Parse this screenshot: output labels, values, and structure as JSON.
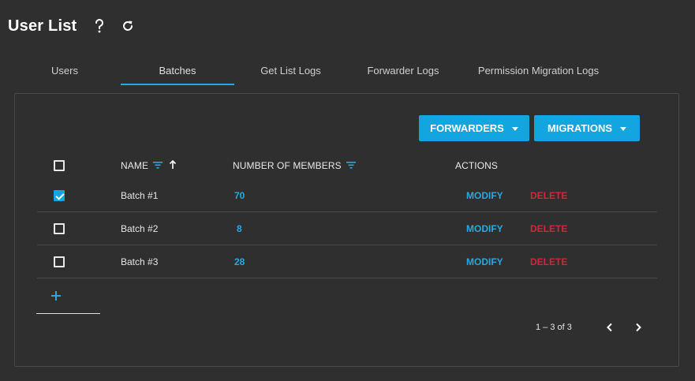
{
  "header": {
    "title": "User List"
  },
  "tabs": [
    {
      "label": "Users",
      "active": false
    },
    {
      "label": "Batches",
      "active": true
    },
    {
      "label": "Get List Logs",
      "active": false
    },
    {
      "label": "Forwarder Logs",
      "active": false
    },
    {
      "label": "Permission Migration Logs",
      "active": false
    }
  ],
  "toolbar": {
    "forwarders_label": "FORWARDERS",
    "migrations_label": "MIGRATIONS"
  },
  "table": {
    "columns": {
      "name": "NAME",
      "members": "NUMBER OF MEMBERS",
      "actions": "ACTIONS"
    },
    "rows": [
      {
        "name": "Batch #1",
        "members": "70",
        "checked": true,
        "modify": "MODIFY",
        "delete": "DELETE"
      },
      {
        "name": "Batch #2",
        "members": "8",
        "checked": false,
        "modify": "MODIFY",
        "delete": "DELETE"
      },
      {
        "name": "Batch #3",
        "members": "28",
        "checked": false,
        "modify": "MODIFY",
        "delete": "DELETE"
      }
    ]
  },
  "pagination": {
    "range": "1 – 3 of 3"
  },
  "icons": {
    "help": "help-icon",
    "refresh": "refresh-icon",
    "filter": "filter-icon",
    "sort": "sort-asc-icon",
    "add": "plus-icon",
    "prev": "chevron-left-icon",
    "next": "chevron-right-icon"
  },
  "colors": {
    "accent": "#12a5e0",
    "danger": "#d3263a",
    "background": "#2f2f2f"
  }
}
